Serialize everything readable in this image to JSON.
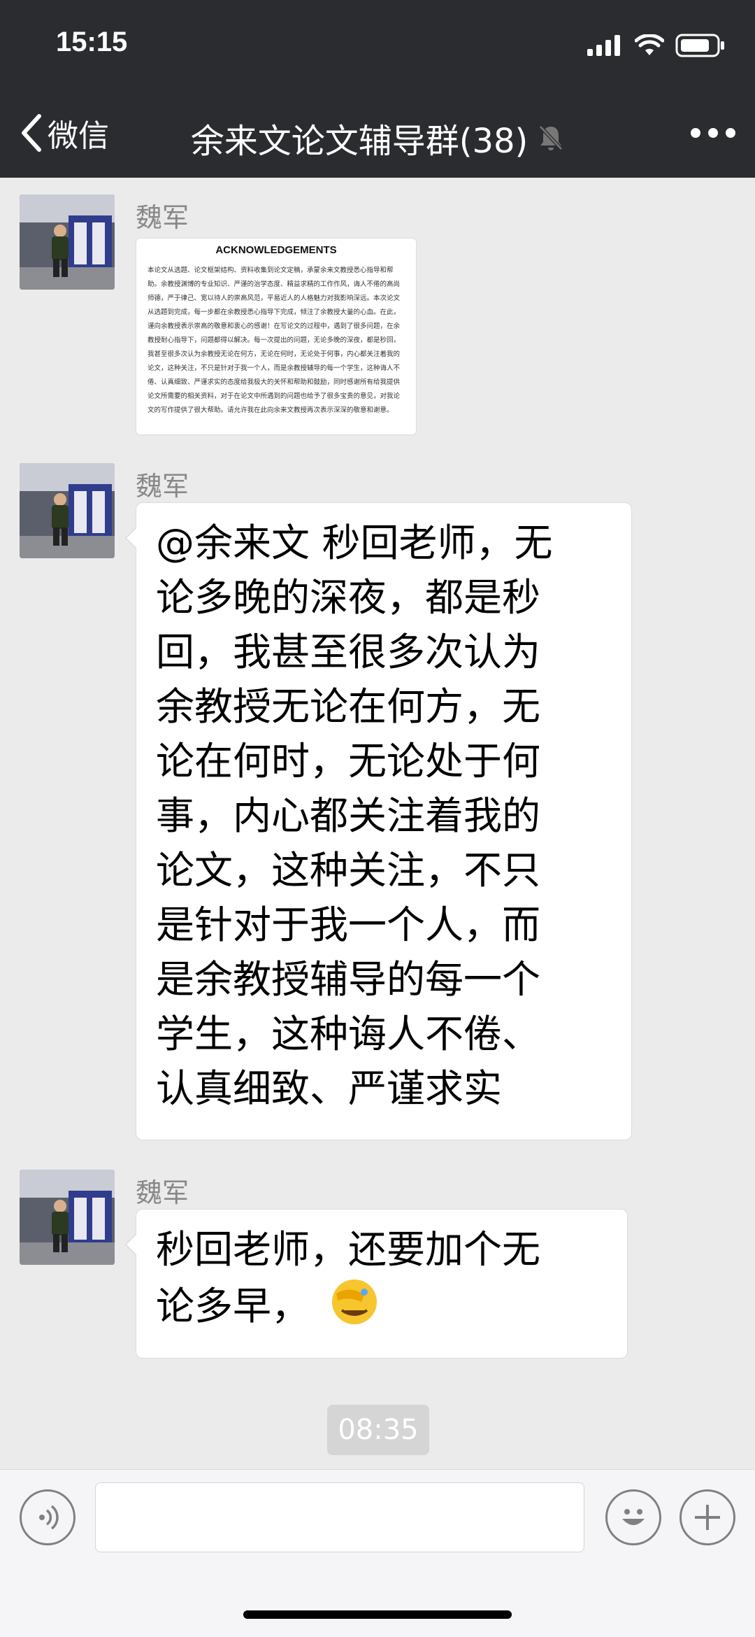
{
  "status": {
    "time": "15:15"
  },
  "nav": {
    "back_label": "微信",
    "title": "余来文论文辅导群(38)"
  },
  "messages": [
    {
      "sender": "魏军",
      "type": "image",
      "doc": {
        "heading": "ACKNOWLEDGEMENTS",
        "body": "本论文从选题、论文框架结构、资料收集到论文定稿，承蒙余来文教授悉心指导和帮助。余教授渊博的专业知识、严谨的治学态度、精益求精的工作作风，诲人不倦的高尚师德，严于律己、宽以待人的崇高风范，平易近人的人格魅力对我影响深远。本次论文从选题到完成，每一步都在余教授悉心指导下完成，倾注了余教授大量的心血。在此，谨向余教授表示崇高的敬意和衷心的感谢！在写论文的过程中，遇到了很多问题，在余教授耐心指导下，问题都得以解决。每一次提出的问题，无论多晚的深夜，都是秒回，我甚至很多次认为余教授无论在何方，无论在何时，无论处于何事，内心都关注着我的论文，这种关注，不只是针对于我一个人，而是余教授辅导的每一个学生，这种诲人不倦、认真细致、严谨求实的态度给我极大的关怀和帮助和鼓励，同时感谢所有给我提供论文所需要的相关资料，对于在论文中所遇到的问题也给予了很多宝贵的意见，对我论文的写作提供了很大帮助。请允许我在此向余来文教授再次表示深深的敬意和谢意。"
      }
    },
    {
      "sender": "魏军",
      "type": "text",
      "lines": [
        "@余来文 秒回老师，无",
        "论多晚的深夜，都是秒",
        "回，我甚至很多次认为",
        "余教授无论在何方，无",
        "论在何时，无论处于何",
        "事，内心都关注着我的",
        "论文，这种关注，不只",
        "是针对于我一个人，而",
        "是余教授辅导的每一个",
        "学生，这种诲人不倦、",
        "认真细致、严谨求实"
      ]
    },
    {
      "sender": "魏军",
      "type": "text",
      "lines": [
        "秒回老师，还要加个无",
        "论多早，"
      ],
      "emoji": "🤦"
    }
  ],
  "timestamp": "08:35",
  "input": {
    "value": ""
  },
  "icons": {
    "back": "chevron-left-icon",
    "mute": "bell-muted-icon",
    "more": "more-dots-icon",
    "voice": "voice-icon",
    "emoji": "emoji-icon",
    "plus": "plus-icon"
  }
}
